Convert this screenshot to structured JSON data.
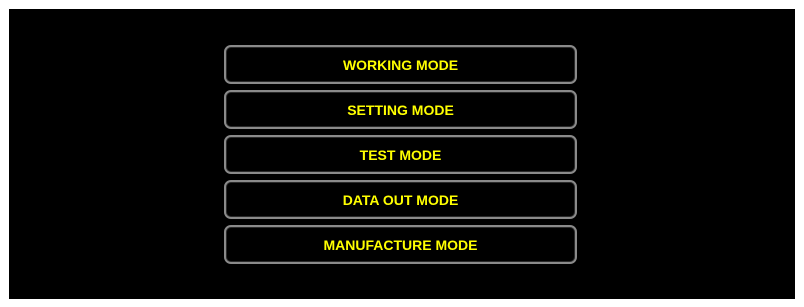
{
  "menu": {
    "items": [
      {
        "label": "WORKING MODE"
      },
      {
        "label": "SETTING MODE"
      },
      {
        "label": "TEST MODE"
      },
      {
        "label": "DATA OUT MODE"
      },
      {
        "label": "MANUFACTURE MODE"
      }
    ]
  },
  "colors": {
    "background": "#000000",
    "text": "#ffff00",
    "border": "#8a8a8a",
    "frame": "#ffffff"
  }
}
